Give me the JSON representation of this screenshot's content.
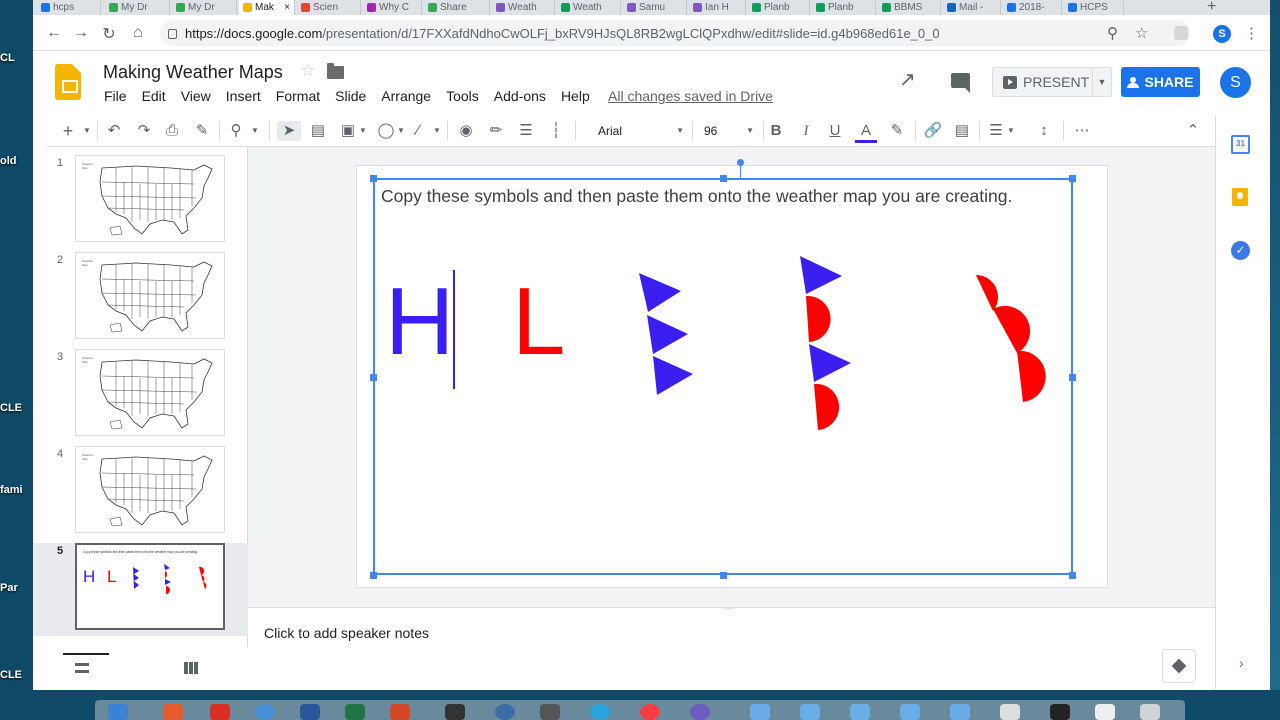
{
  "browser": {
    "tabs": [
      {
        "label": "hcps",
        "color": "#1a73e8",
        "active": false
      },
      {
        "label": "My Dr",
        "color": "#34a853",
        "active": false
      },
      {
        "label": "My Dr",
        "color": "#34a853",
        "active": false
      },
      {
        "label": "Mak",
        "color": "#f4b400",
        "active": true
      },
      {
        "label": "Scien",
        "color": "#ea4335",
        "active": false
      },
      {
        "label": "Why C",
        "color": "#9c27b0",
        "active": false
      },
      {
        "label": "Share",
        "color": "#34a853",
        "active": false
      },
      {
        "label": "Weath",
        "color": "#7e57c2",
        "active": false
      },
      {
        "label": "Weath",
        "color": "#0f9d58",
        "active": false
      },
      {
        "label": "Samu",
        "color": "#7e57c2",
        "active": false
      },
      {
        "label": "Ian H",
        "color": "#7e57c2",
        "active": false
      },
      {
        "label": "Planb",
        "color": "#0f9d58",
        "active": false
      },
      {
        "label": "Planb",
        "color": "#0f9d58",
        "active": false
      },
      {
        "label": "BBMS",
        "color": "#0f9d58",
        "active": false
      },
      {
        "label": "Mail -",
        "color": "#1565c0",
        "active": false
      },
      {
        "label": "2018-",
        "color": "#1a73e8",
        "active": false
      },
      {
        "label": "HCPS",
        "color": "#1a73e8",
        "active": false
      }
    ],
    "new_tab_icon": "+",
    "url_host": "https://docs.google.com",
    "url_path": "/presentation/d/17FXXafdNdhoCwOLFj_bxRV9HJsQL8RB2wgLClQPxdhw/edit#slide=id.g4b968ed61e_0_0",
    "profile_initial": "S"
  },
  "desktop": {
    "labels": [
      "CL",
      "old",
      "CLE",
      "fami",
      "Par",
      "CLE"
    ]
  },
  "app": {
    "title": "Making Weather Maps",
    "menu": [
      "File",
      "Edit",
      "View",
      "Insert",
      "Format",
      "Slide",
      "Arrange",
      "Tools",
      "Add-ons",
      "Help"
    ],
    "saved_status": "All changes saved in Drive",
    "present_label": "PRESENT",
    "share_label": "SHARE",
    "user_initial": "S"
  },
  "toolbar": {
    "font": "Arial",
    "font_size": "96"
  },
  "slides": {
    "numbers": [
      "1",
      "2",
      "3",
      "4",
      "5"
    ],
    "selected": 5,
    "thumb_caption_5": "Copy these symbols and then paste them onto the weather map you are creating.",
    "thumb_symbols_5": [
      "H",
      "L"
    ]
  },
  "slide": {
    "instruction": "Copy these symbols and then paste them onto the weather map you are creating.",
    "symbols": {
      "high": "H",
      "low": "L"
    },
    "colors": {
      "blue": "#3a1ff0",
      "red": "#ff0000",
      "selection": "#4285f4"
    }
  },
  "notes": {
    "placeholder": "Click to add speaker notes"
  },
  "side_panel": {
    "calendar_day": "31"
  }
}
